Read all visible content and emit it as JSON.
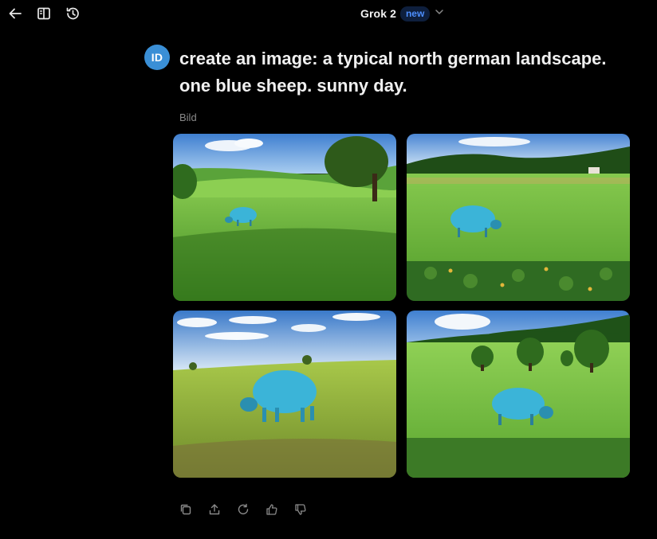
{
  "header": {
    "model_name": "Grok 2",
    "badge": "new",
    "icons": [
      "back-arrow-icon",
      "sidebar-toggle-icon",
      "history-icon",
      "chevron-down-icon"
    ]
  },
  "message": {
    "avatar_initials": "ID",
    "avatar_color": "#3a8fd6",
    "prompt": "create an image: a typical north german landscape. one blue sheep. sunny day."
  },
  "response": {
    "label": "Bild",
    "images": [
      {
        "alt": "generated image 1"
      },
      {
        "alt": "generated image 2"
      },
      {
        "alt": "generated image 3"
      },
      {
        "alt": "generated image 4"
      }
    ],
    "actions": [
      "copy-icon",
      "share-icon",
      "regenerate-icon",
      "thumbs-up-icon",
      "thumbs-down-icon"
    ]
  },
  "colors": {
    "background": "#000000",
    "badge_text": "#4d8fff",
    "badge_bg": "#0e1f3d",
    "sheep": "#3bb4d8"
  }
}
